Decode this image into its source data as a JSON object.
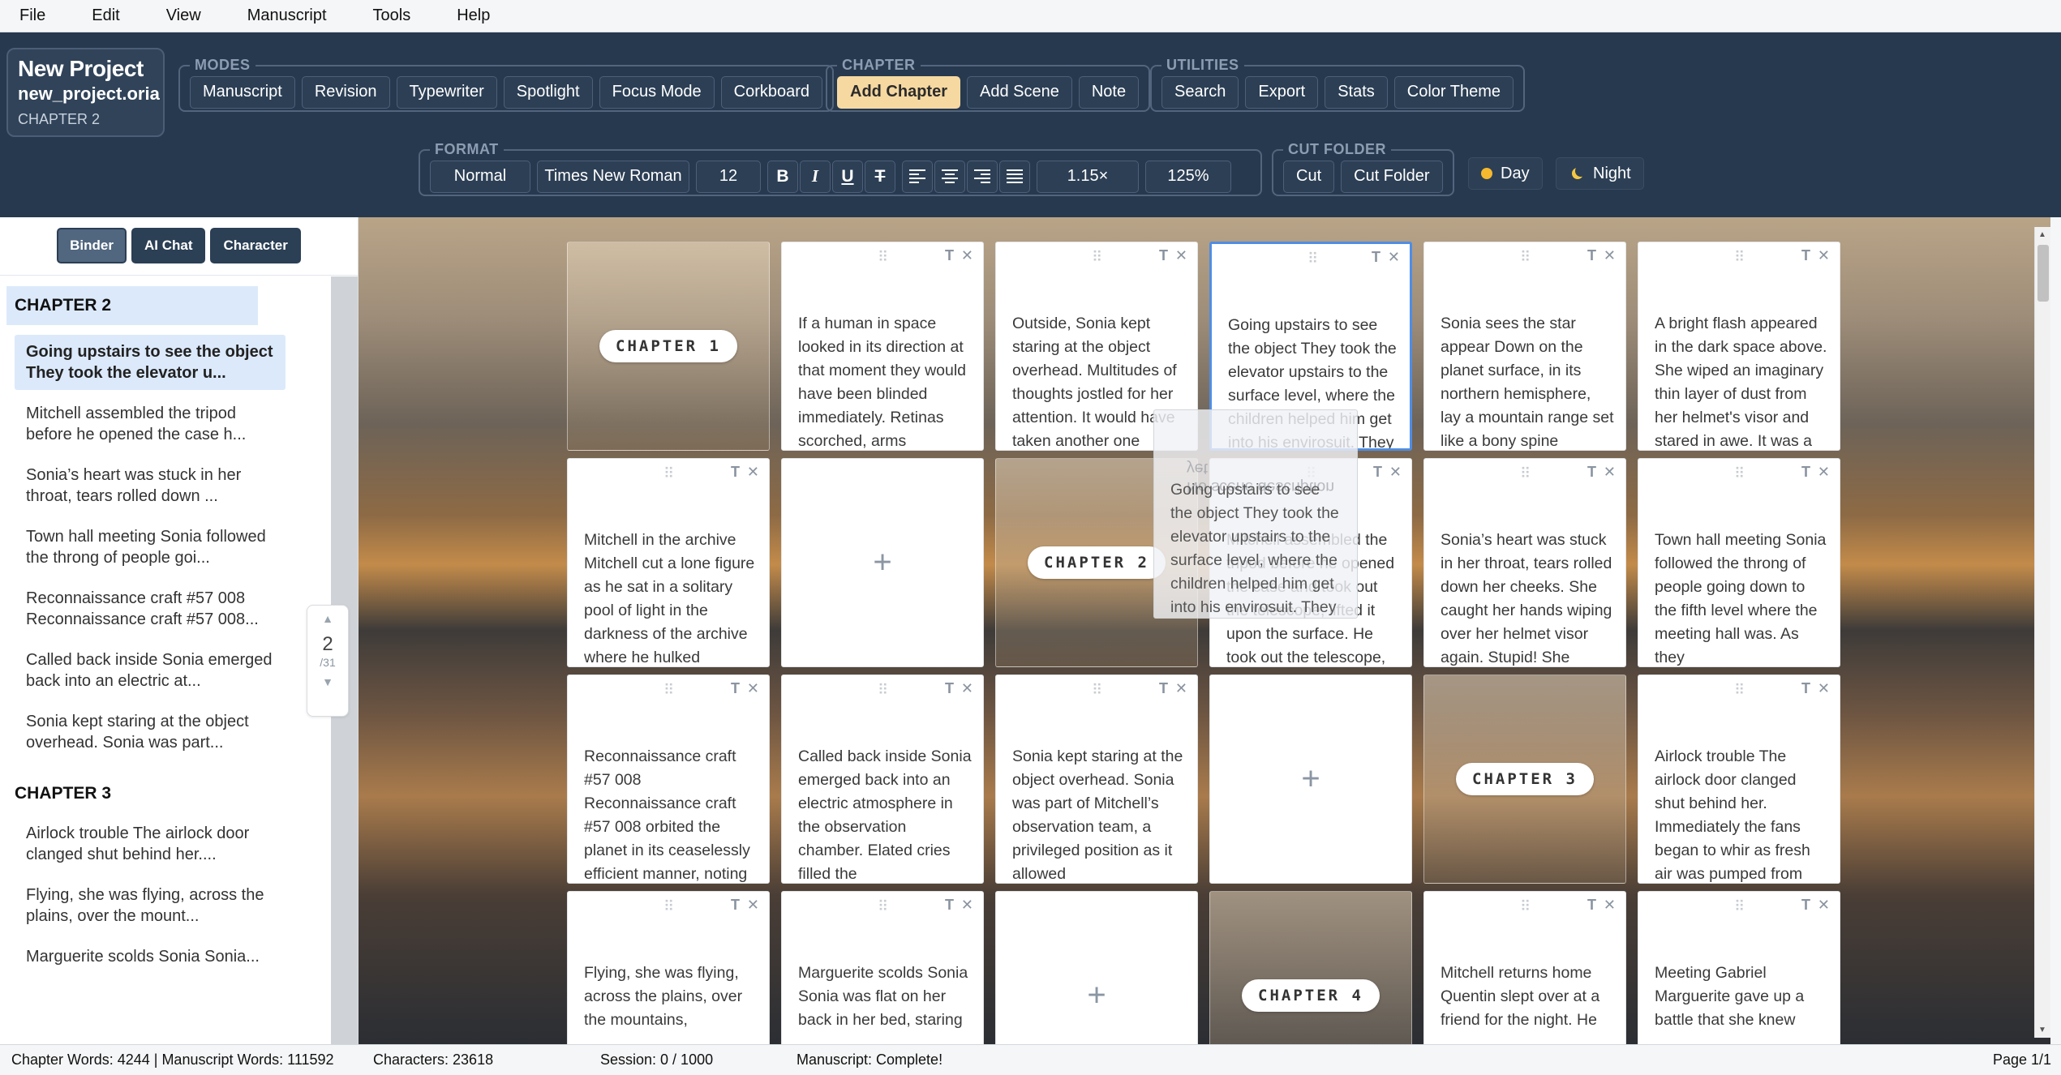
{
  "menu": [
    "File",
    "Edit",
    "View",
    "Manuscript",
    "Tools",
    "Help"
  ],
  "project": {
    "name": "New Project",
    "file": "new_project.oria",
    "chapter": "CHAPTER 2"
  },
  "groups": {
    "modes": {
      "legend": "MODES",
      "buttons": [
        "Manuscript",
        "Revision",
        "Typewriter",
        "Spotlight",
        "Focus Mode",
        "Corkboard"
      ]
    },
    "chapter": {
      "legend": "CHAPTER",
      "buttons": [
        "Add Chapter",
        "Add Scene",
        "Note"
      ],
      "active": "Add Chapter"
    },
    "utilities": {
      "legend": "UTILITIES",
      "buttons": [
        "Search",
        "Export",
        "Stats",
        "Color Theme"
      ]
    },
    "format": {
      "legend": "FORMAT",
      "style": "Normal",
      "font": "Times New Roman",
      "size": "12",
      "bold": "B",
      "italic": "I",
      "underline": "U",
      "strike": "T",
      "spacing": "1.15×",
      "zoom": "125%"
    },
    "cut": {
      "legend": "CUT FOLDER",
      "buttons": [
        "Cut",
        "Cut Folder"
      ]
    },
    "theme": {
      "day": "Day",
      "night": "Night"
    }
  },
  "sidebar": {
    "tabs": [
      "Binder",
      "AI Chat",
      "Character"
    ],
    "active_tab": "Binder",
    "chapter2": "CHAPTER 2",
    "items2": [
      "Going upstairs to see the object They took the elevator u...",
      "Mitchell assembled the tripod before he opened the case h...",
      "Sonia’s heart was stuck in her throat, tears rolled down ...",
      "Town hall meeting Sonia followed the throng of people goi...",
      "Reconnaissance craft #57 008 Reconnaissance craft #57 008...",
      "Called back inside Sonia emerged back into an electric at...",
      "Sonia kept staring at the object overhead. Sonia was part..."
    ],
    "chapter3": "CHAPTER 3",
    "items3": [
      "Airlock trouble The airlock door clanged shut behind her....",
      "Flying, she was flying, across the plains, over the mount...",
      "Marguerite scolds Sonia Sonia..."
    ],
    "pager": {
      "current": "2",
      "total": "/31"
    }
  },
  "cards": [
    {
      "kind": "chapter",
      "label": "CHAPTER 1"
    },
    {
      "kind": "scene",
      "text": "If a human in space looked in its direction at that moment they would have been blinded immediately. Retinas scorched, arms"
    },
    {
      "kind": "scene",
      "text": "Outside, Sonia kept staring at the object overhead. Multitudes of thoughts jostled for her attention. It would have taken another one"
    },
    {
      "kind": "scene",
      "selected": true,
      "text": "Going upstairs to see the object They took the elevator upstairs to the surface level, where the children helped him get into his envirosuit. They"
    },
    {
      "kind": "scene",
      "text": "Sonia sees the star appear Down on the planet surface, in its northern hemisphere, lay a mountain range set like a bony spine"
    },
    {
      "kind": "scene",
      "text": "A bright flash appeared in the dark space above. She wiped an imaginary thin layer of dust from her helmet's visor and stared in awe. It was a"
    },
    {
      "kind": "scene",
      "text": "Mitchell in the archive Mitchell cut a lone figure as he sat in a solitary pool of light in the darkness of the archive where he hulked"
    },
    {
      "kind": "add",
      "label": "+"
    },
    {
      "kind": "chapter",
      "label": "CHAPTER 2"
    },
    {
      "kind": "scene",
      "text": "Mitchell assembled the tripod before he opened the case and took out the telescope, lifted it upon the surface. He took out the telescope, lifted it upon"
    },
    {
      "kind": "scene",
      "text": "Sonia’s heart was stuck in her throat, tears rolled down her cheeks. She caught her hands wiping over her helmet visor again. Stupid! She"
    },
    {
      "kind": "scene",
      "text": "Town hall meeting Sonia followed the throng of people going down to the fifth level where the meeting hall was. As they"
    },
    {
      "kind": "scene",
      "text": "Reconnaissance craft #57 008 Reconnaissance craft #57 008 orbited the planet in its ceaselessly efficient manner, noting"
    },
    {
      "kind": "scene",
      "text": "Called back inside Sonia emerged back into an electric atmosphere in the observation chamber. Elated cries filled the"
    },
    {
      "kind": "scene",
      "text": "Sonia kept staring at the object overhead. Sonia was part of Mitchell’s observation team, a privileged position as it allowed"
    },
    {
      "kind": "add",
      "label": "+"
    },
    {
      "kind": "chapter",
      "label": "CHAPTER 3"
    },
    {
      "kind": "scene",
      "text": "Airlock trouble The airlock door clanged shut behind her. Immediately the fans began to whir as fresh air was pumped from"
    },
    {
      "kind": "scene",
      "text": "Flying, she was flying, across the plains, over the mountains,"
    },
    {
      "kind": "scene",
      "text": "Marguerite scolds Sonia Sonia was flat on her back in her bed, staring"
    },
    {
      "kind": "add",
      "label": "+"
    },
    {
      "kind": "chapter",
      "label": "CHAPTER 4"
    },
    {
      "kind": "scene",
      "text": "Mitchell returns home Quentin slept over at a friend for the night. He"
    },
    {
      "kind": "scene",
      "text": "Meeting Gabriel Marguerite gave up a battle that she knew"
    }
  ],
  "ghost": {
    "text": "Going upstairs to see the object They took the elevator upstairs to the surface level, where the children helped him get into his envirosuit. They",
    "mirror": "No scene description yet"
  },
  "status": {
    "chapter_words": "Chapter Words: 4244 | Manuscript Words: 111592",
    "characters": "Characters: 23618",
    "session": "Session: 0 / 1000",
    "manuscript": "Manuscript: Complete!",
    "page": "Page 1/1"
  },
  "icons": {
    "drag": "drag-handle-icon",
    "type": "text-type-icon",
    "close": "close-icon",
    "add": "plus-icon",
    "sun": "sun-icon",
    "moon": "moon-icon"
  },
  "colors": {
    "toolbar": "#27394f",
    "accent": "#f6d9a1",
    "selection": "#4f8de3",
    "binder_select": "#dbe9fb"
  }
}
